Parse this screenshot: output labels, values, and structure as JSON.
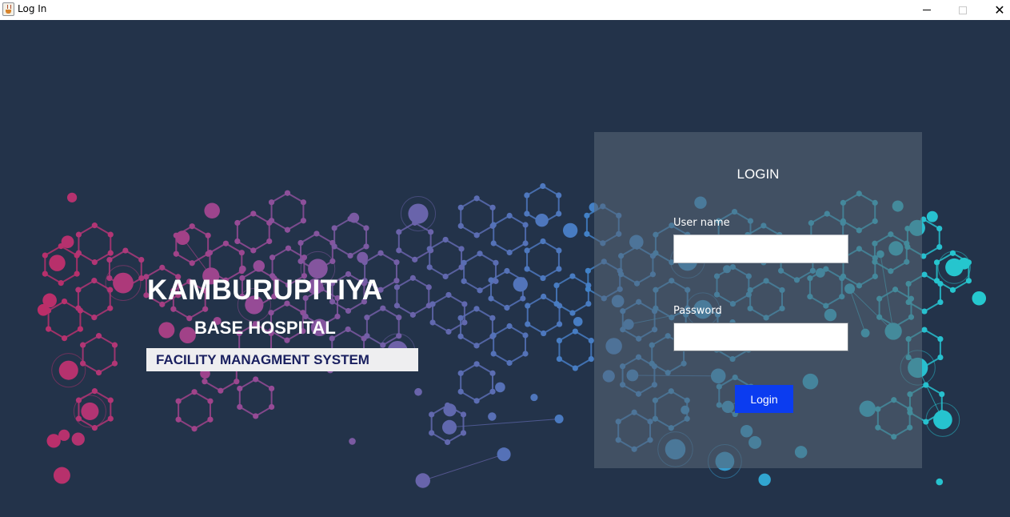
{
  "window": {
    "title": "Log In",
    "icon": "java-cup-icon",
    "controls": {
      "minimize": "minimize-icon",
      "maximize": "maximize-icon",
      "close": "close-icon"
    }
  },
  "brand": {
    "title": "KAMBURUPITIYA",
    "subtitle": "BASE HOSPITAL",
    "tagline": "FACILITY MANAGMENT SYSTEM"
  },
  "login": {
    "heading": "LOGIN",
    "username_label": "User name",
    "username_value": "",
    "password_label": "Password",
    "password_value": "",
    "button_label": "Login"
  },
  "colors": {
    "background": "#23334a",
    "button": "#0b3cf0",
    "tagline_text": "#1a2060",
    "network_left": "#c2285f",
    "network_mid": "#4f80c9",
    "network_right": "#27c8d0"
  }
}
